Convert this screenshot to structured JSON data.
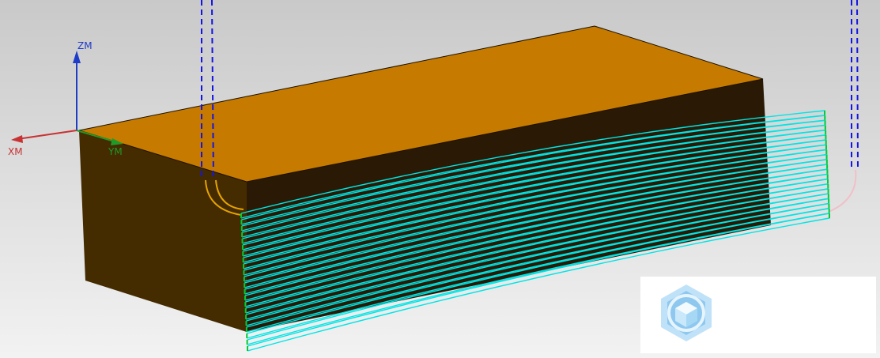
{
  "viewport": {
    "background_top": "#c9c9c9",
    "background_bottom": "#f2f2f2"
  },
  "model": {
    "top_color": "#c67a00",
    "side_color": "#442b00",
    "front_color": "#2a1a05",
    "edge_color": "#1a1000"
  },
  "toolpath": {
    "cut_color": "#00e5e5",
    "engage_color": "#00cc33",
    "approach_color": "#1414e6",
    "lead_in_color": "#e6a400",
    "lead_out_color": "#f0c0c8",
    "passes": 22
  },
  "csys": {
    "z_label": "ZM",
    "x_label": "XM",
    "y_label": "YM",
    "z_color": "#1e3cc8",
    "x_color": "#c83232",
    "y_color": "#1f9a28"
  },
  "watermark": {
    "icon": "cube-logo-icon"
  }
}
